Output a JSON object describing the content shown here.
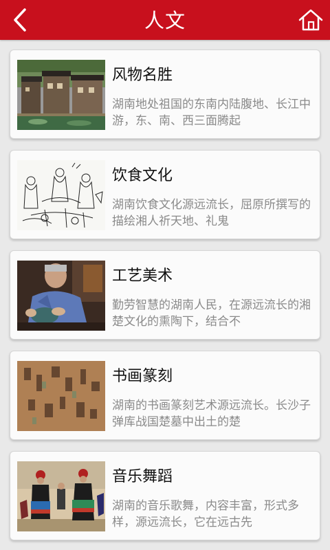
{
  "header": {
    "title": "人文",
    "back_icon": "back-chevron-icon",
    "home_icon": "home-icon"
  },
  "items": [
    {
      "title": "风物名胜",
      "desc": "湖南地处祖国的东南内陆腹地、长江中游，东、南、西三面腾起"
    },
    {
      "title": "饮食文化",
      "desc": "湖南饮食文化源远流长，屈原所撰写的描绘湘人祈天地、礼鬼"
    },
    {
      "title": "工艺美术",
      "desc": "勤劳智慧的湖南人民，在源远流长的湘楚文化的熏陶下，结合不"
    },
    {
      "title": "书画篆刻",
      "desc": "湖南的书画篆刻艺术源远流长。长沙子弹库战国楚墓中出土的楚"
    },
    {
      "title": "音乐舞蹈",
      "desc": "湖南的音乐歌舞，内容丰富，形式多样，源远流长，它在远古先"
    }
  ],
  "colors": {
    "header_red": "#c8101d",
    "background": "#e9e9e9",
    "desc_gray": "#8a8a8a"
  }
}
